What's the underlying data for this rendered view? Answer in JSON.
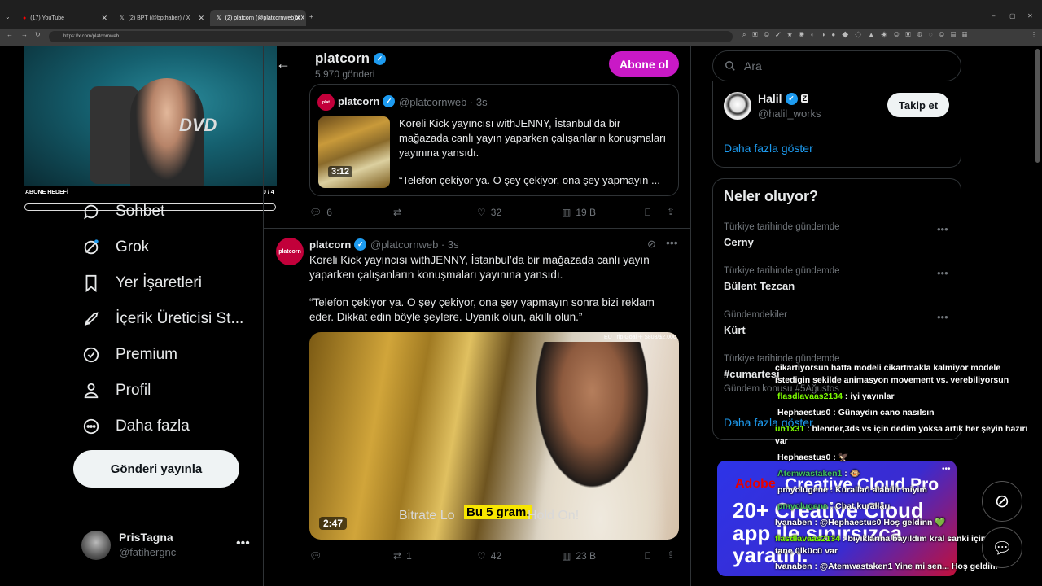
{
  "browser": {
    "tabs": [
      {
        "title": "(17) YouTube",
        "active": false
      },
      {
        "title": "(2) BPT (@bpthaber) / X",
        "active": false
      },
      {
        "title": "(2) platcorn (@platcornweb) / X",
        "active": true
      }
    ],
    "url": "https://x.com/platcornweb"
  },
  "webcam": {
    "goal_label": "ABONE HEDEFİ",
    "goal_count": "0 / 4",
    "goal_progress": 0
  },
  "sidebar": {
    "items": [
      {
        "label": "Sohbet",
        "icon": "message-icon"
      },
      {
        "label": "Grok",
        "icon": "grok-icon"
      },
      {
        "label": "Yer İşaretleri",
        "icon": "bookmark-icon"
      },
      {
        "label": "İçerik Üreticisi St...",
        "icon": "rocket-icon"
      },
      {
        "label": "Premium",
        "icon": "verified-badge-icon"
      },
      {
        "label": "Profil",
        "icon": "person-icon"
      },
      {
        "label": "Daha fazla",
        "icon": "more-circle-icon"
      }
    ],
    "post_button": "Gönderi yayınla",
    "account": {
      "name": "PrisTagna",
      "handle": "@fatihergnc"
    }
  },
  "profile": {
    "name": "platcorn",
    "post_count": "5.970 gönderi",
    "subscribe_label": "Abone ol"
  },
  "quoted_tweet": {
    "name": "platcorn",
    "handle": "@platcornweb · 3s",
    "text": "Koreli Kick yayıncısı withJENNY, İstanbul’da bir mağazada canlı yayın yaparken çalışanların konuşmaları yayınına yansıdı.",
    "text2": "“Telefon çekiyor ya. O şey çekiyor, ona şey yapmayın ...",
    "duration": "3:12",
    "replies": "6",
    "likes": "32",
    "views": "19 B"
  },
  "tweet": {
    "name": "platcorn",
    "handle": "@platcornweb · 3s",
    "text": "Koreli Kick yayıncısı withJENNY, İstanbul’da bir mağazada canlı yayın yaparken çalışanların konuşmaları yayınına yansıdı.",
    "text2": "“Telefon çekiyor ya. O şey çekiyor, ona şey yapmayın sonra bizi reklam eder. Dikkat edin böyle şeylere. Uyanık olun, akıllı olun.”",
    "video": {
      "goal": "EU Trip Goal ✈ $803/$2,000",
      "sub_left": "Bitrate Lo",
      "sub_highlight": "Bu 5 gram.",
      "sub_right": "Hold On!",
      "duration": "2:47"
    },
    "reposts": "1",
    "likes": "42",
    "views": "23 B"
  },
  "right": {
    "search_placeholder": "Ara",
    "who_to_follow": {
      "name": "Halil",
      "handle": "@halil_works",
      "follow_label": "Takip et",
      "show_more": "Daha fazla göster"
    },
    "trends_title": "Neler oluyor?",
    "trends": [
      {
        "context": "Türkiye tarihinde gündemde",
        "name": "Cerny"
      },
      {
        "context": "Türkiye tarihinde gündemde",
        "name": "Bülent Tezcan"
      },
      {
        "context": "Gündemdekiler",
        "name": "Kürt"
      },
      {
        "context": "Türkiye tarihinde gündemde",
        "name": "#cumartesi"
      }
    ],
    "trend_extra": "Gündem konusu  #5Ağustos",
    "show_more": "Daha fazla göster",
    "ad": {
      "brand": "Adobe",
      "product": "Creative Cloud Pro",
      "line1": "20+ Creative Cloud",
      "line2": "app ile sınırsızca",
      "line3": "yaratın."
    }
  },
  "chat": [
    {
      "user": "",
      "text": "cikartiyorsun hatta modeli cikartmakla kalmiyor modele istedigin sekilde animasyon movement vs. verebiliyorsun"
    },
    {
      "user": "flasdlavaas2134",
      "text": ": iyi yayınlar"
    },
    {
      "user": "Hephaestus0",
      "text": ": Günaydın cano nasılsın"
    },
    {
      "user": "un1x31",
      "text": ": blender,3ds vs için dedim yoksa artık her şeyin hazırı var"
    },
    {
      "user": "Hephaestus0",
      "text": ": 🦅"
    },
    {
      "user": "Atemwastaken1",
      "text": ": 🐵"
    },
    {
      "user": "pmyolugene",
      "text": ": Kuralları alabilir miyim"
    },
    {
      "user": "pmyolugene",
      "text": ": Chat kuralları"
    },
    {
      "user": "Ivanaben",
      "text": ": @Hephaestus0 Hoş geldinn 💚"
    },
    {
      "user": "flasdlavaas2134",
      "text": ": bıyıklarına bayıldım kral sanki içinde 40 tane ülkücü var"
    },
    {
      "user": "Ivanaben",
      "text": ": @Atemwastaken1 Yine mi sen... Hoş geldin."
    }
  ]
}
